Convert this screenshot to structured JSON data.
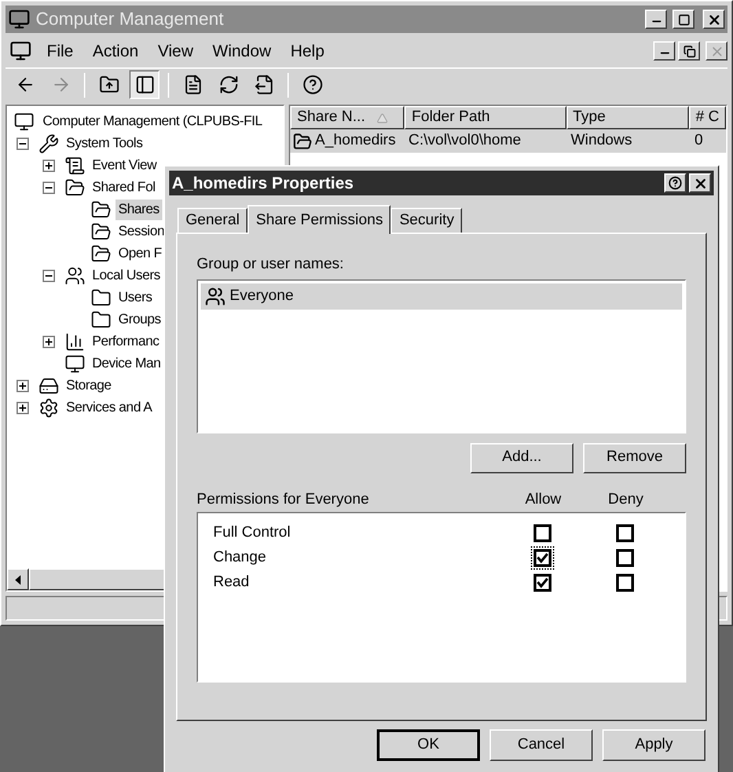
{
  "window": {
    "title": "Computer Management"
  },
  "menu": [
    "File",
    "Action",
    "View",
    "Window",
    "Help"
  ],
  "mdi_close_disabled": true,
  "toolbar": [
    {
      "kind": "back",
      "disabled": false,
      "pressed": false
    },
    {
      "kind": "forward",
      "disabled": true,
      "pressed": false
    },
    {
      "kind": "up",
      "disabled": false,
      "pressed": false
    },
    {
      "kind": "tree",
      "disabled": false,
      "pressed": true
    },
    {
      "kind": "properties",
      "disabled": false,
      "pressed": false
    },
    {
      "kind": "refresh",
      "disabled": false,
      "pressed": false
    },
    {
      "kind": "export",
      "disabled": false,
      "pressed": false
    },
    {
      "kind": "help",
      "disabled": false,
      "pressed": false
    }
  ],
  "tree": [
    {
      "label": "Computer Management (CLPUBS-FIL",
      "kind": "computer",
      "selected": false,
      "children": [
        {
          "label": "System Tools",
          "kind": "tools",
          "selected": false,
          "expanded": true,
          "children": [
            {
              "label": "Event View",
              "kind": "log",
              "selected": false,
              "expanded": false
            },
            {
              "label": "Shared Fol",
              "kind": "share",
              "selected": false,
              "expanded": true,
              "children": [
                {
                  "label": "Shares",
                  "kind": "share",
                  "selected": true
                },
                {
                  "label": "Session",
                  "kind": "share",
                  "selected": false
                },
                {
                  "label": "Open F",
                  "kind": "share",
                  "selected": false
                }
              ]
            },
            {
              "label": "Local Users",
              "kind": "users",
              "selected": false,
              "expanded": true,
              "children": [
                {
                  "label": "Users",
                  "kind": "folder",
                  "selected": false
                },
                {
                  "label": "Groups",
                  "kind": "folder",
                  "selected": false
                }
              ]
            },
            {
              "label": "Performanc",
              "kind": "chart",
              "selected": false,
              "expanded": false
            },
            {
              "label": "Device Man",
              "kind": "computer",
              "selected": false
            }
          ]
        },
        {
          "label": "Storage",
          "kind": "drive",
          "selected": false,
          "expanded": false
        },
        {
          "label": "Services and A",
          "kind": "gear",
          "selected": false,
          "expanded": false
        }
      ]
    }
  ],
  "table": {
    "columns": [
      "Share N...",
      "Folder Path",
      "Type",
      "# C"
    ],
    "rows": [
      {
        "cells": [
          "A_homedirs",
          "C:\\vol\\vol0\\home",
          "Windows",
          "0"
        ],
        "selected": true
      }
    ]
  },
  "dialog": {
    "title": "A_homedirs Properties",
    "tabs": [
      {
        "label": "General",
        "selected": false
      },
      {
        "label": "Share Permissions",
        "selected": true
      },
      {
        "label": "Security",
        "selected": false
      }
    ],
    "group_label": "Group or user names:",
    "users": [
      {
        "name": "Everyone",
        "selected": true
      }
    ],
    "list_buttons": [
      "Add...",
      "Remove"
    ],
    "permissions_label": "Permissions for Everyone",
    "allow_header": "Allow",
    "deny_header": "Deny",
    "permissions": [
      {
        "name": "Full Control",
        "allow": false,
        "deny": false,
        "focused": false
      },
      {
        "name": "Change",
        "allow": true,
        "deny": false,
        "focused": true
      },
      {
        "name": "Read",
        "allow": true,
        "deny": false,
        "focused": false
      }
    ],
    "buttons": [
      {
        "label": "OK",
        "default": true
      },
      {
        "label": "Cancel",
        "default": false
      },
      {
        "label": "Apply",
        "default": false
      }
    ]
  }
}
